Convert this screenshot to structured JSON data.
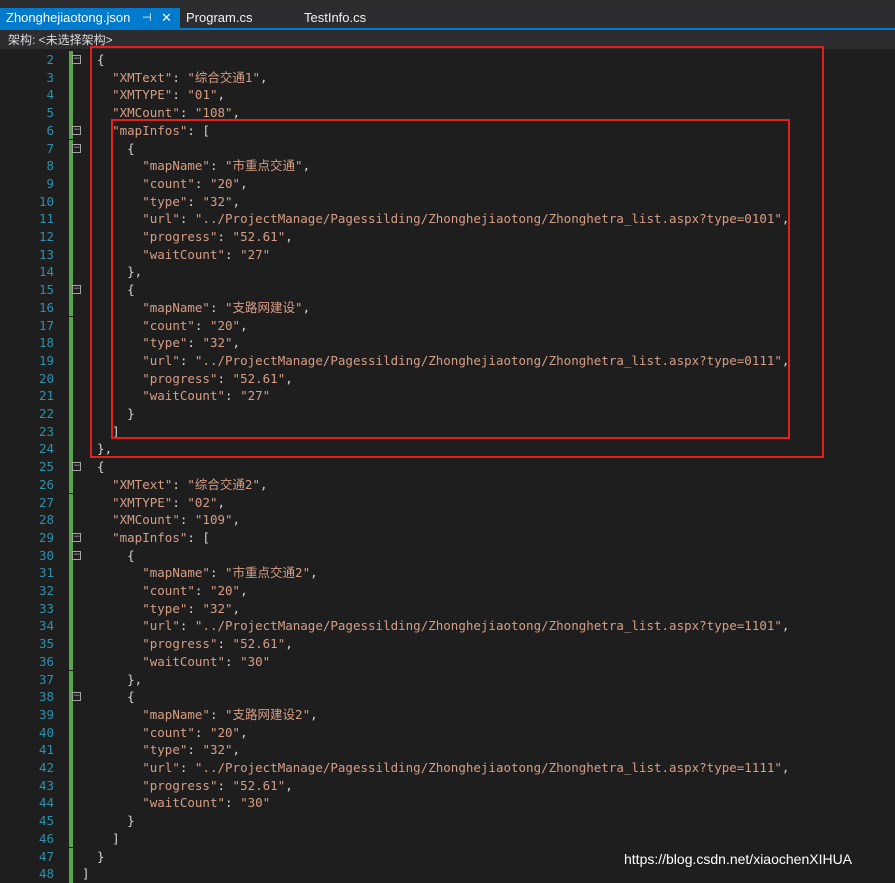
{
  "tabs": [
    {
      "label": "Zhonghejiaotong.json",
      "active": true
    },
    {
      "label": "Program.cs",
      "active": false
    },
    {
      "label": "TestInfo.cs",
      "active": false
    }
  ],
  "tab_pin_icon": "pin-icon",
  "tab_close_icon": "close-icon",
  "navbar": {
    "label": "架构: <未选择架构>"
  },
  "colors": {
    "accent": "#007acc",
    "string": "#d69d85",
    "line_number": "#2b91af",
    "highlight_box": "#e51e1e",
    "change_bar": "#57a64a"
  },
  "code_lines": [
    {
      "n": "2",
      "text": "  {"
    },
    {
      "n": "3",
      "text": "    \"XMText\": \"综合交通1\","
    },
    {
      "n": "4",
      "text": "    \"XMTYPE\": \"01\","
    },
    {
      "n": "5",
      "text": "    \"XMCount\": \"108\","
    },
    {
      "n": "6",
      "text": "    \"mapInfos\": ["
    },
    {
      "n": "7",
      "text": "      {"
    },
    {
      "n": "8",
      "text": "        \"mapName\": \"市重点交通\","
    },
    {
      "n": "9",
      "text": "        \"count\": \"20\","
    },
    {
      "n": "10",
      "text": "        \"type\": \"32\","
    },
    {
      "n": "11",
      "text": "        \"url\": \"../ProjectManage/Pagessilding/Zhonghejiaotong/Zhonghetra_list.aspx?type=0101\","
    },
    {
      "n": "12",
      "text": "        \"progress\": \"52.61\","
    },
    {
      "n": "13",
      "text": "        \"waitCount\": \"27\""
    },
    {
      "n": "14",
      "text": "      },"
    },
    {
      "n": "15",
      "text": "      {"
    },
    {
      "n": "16",
      "text": "        \"mapName\": \"支路网建设\","
    },
    {
      "n": "17",
      "text": "        \"count\": \"20\","
    },
    {
      "n": "18",
      "text": "        \"type\": \"32\","
    },
    {
      "n": "19",
      "text": "        \"url\": \"../ProjectManage/Pagessilding/Zhonghejiaotong/Zhonghetra_list.aspx?type=0111\","
    },
    {
      "n": "20",
      "text": "        \"progress\": \"52.61\","
    },
    {
      "n": "21",
      "text": "        \"waitCount\": \"27\""
    },
    {
      "n": "22",
      "text": "      }"
    },
    {
      "n": "23",
      "text": "    ]"
    },
    {
      "n": "24",
      "text": "  },"
    },
    {
      "n": "25",
      "text": "  {"
    },
    {
      "n": "26",
      "text": "    \"XMText\": \"综合交通2\","
    },
    {
      "n": "27",
      "text": "    \"XMTYPE\": \"02\","
    },
    {
      "n": "28",
      "text": "    \"XMCount\": \"109\","
    },
    {
      "n": "29",
      "text": "    \"mapInfos\": ["
    },
    {
      "n": "30",
      "text": "      {"
    },
    {
      "n": "31",
      "text": "        \"mapName\": \"市重点交通2\","
    },
    {
      "n": "32",
      "text": "        \"count\": \"20\","
    },
    {
      "n": "33",
      "text": "        \"type\": \"32\","
    },
    {
      "n": "34",
      "text": "        \"url\": \"../ProjectManage/Pagessilding/Zhonghejiaotong/Zhonghetra_list.aspx?type=1101\","
    },
    {
      "n": "35",
      "text": "        \"progress\": \"52.61\","
    },
    {
      "n": "36",
      "text": "        \"waitCount\": \"30\""
    },
    {
      "n": "37",
      "text": "      },"
    },
    {
      "n": "38",
      "text": "      {"
    },
    {
      "n": "39",
      "text": "        \"mapName\": \"支路网建设2\","
    },
    {
      "n": "40",
      "text": "        \"count\": \"20\","
    },
    {
      "n": "41",
      "text": "        \"type\": \"32\","
    },
    {
      "n": "42",
      "text": "        \"url\": \"../ProjectManage/Pagessilding/Zhonghejiaotong/Zhonghetra_list.aspx?type=1111\","
    },
    {
      "n": "43",
      "text": "        \"progress\": \"52.61\","
    },
    {
      "n": "44",
      "text": "        \"waitCount\": \"30\""
    },
    {
      "n": "45",
      "text": "      }"
    },
    {
      "n": "46",
      "text": "    ]"
    },
    {
      "n": "47",
      "text": "  }"
    },
    {
      "n": "48",
      "text": "]"
    }
  ],
  "watermark": "https://blog.csdn.net/xiaochenXIHUA"
}
